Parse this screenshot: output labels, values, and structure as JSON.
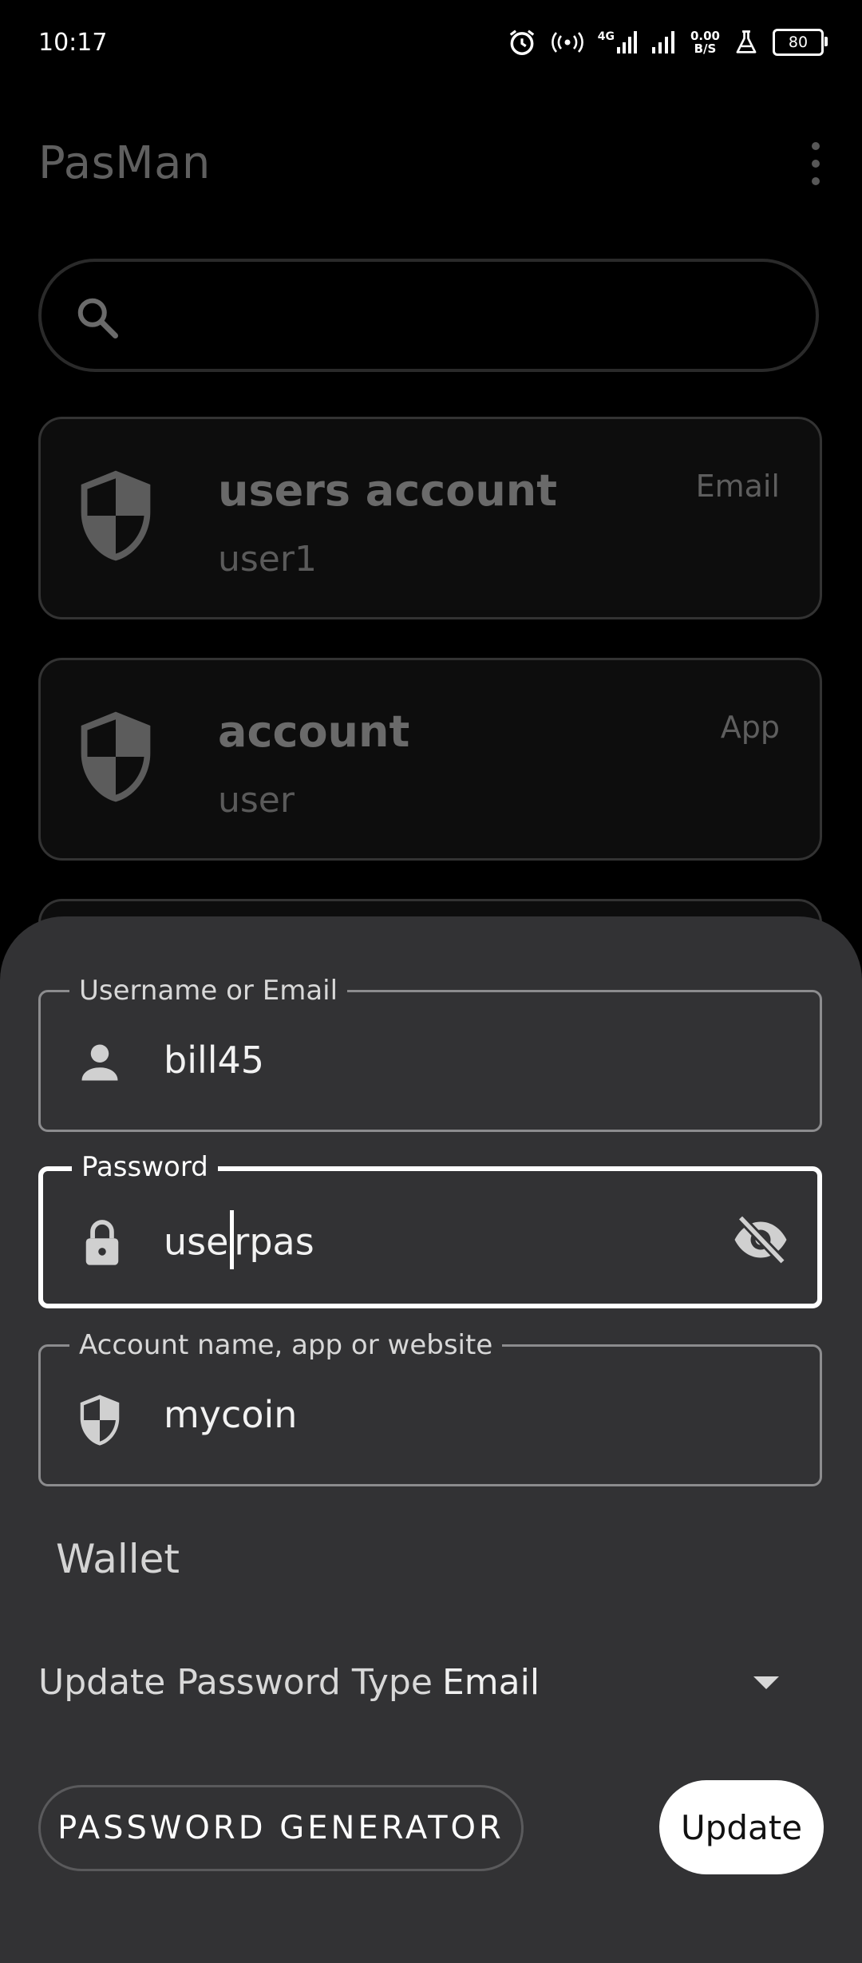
{
  "status_bar": {
    "time": "10:17",
    "network": "4G",
    "speed_value": "0.00",
    "speed_unit": "B/S",
    "battery": "80"
  },
  "app": {
    "title": "PasMan"
  },
  "search": {
    "placeholder": ""
  },
  "accounts": [
    {
      "name": "users account",
      "username": "user1",
      "type": "Email"
    },
    {
      "name": "account",
      "username": "user",
      "type": "App"
    }
  ],
  "form": {
    "username": {
      "label": "Username or Email",
      "value": "bill45"
    },
    "password": {
      "label": "Password",
      "value_before_cursor": "use",
      "value_after_cursor": "rpas"
    },
    "account": {
      "label": "Account name, app or website",
      "value": "mycoin"
    },
    "category": "Wallet",
    "password_type": {
      "label": "Update Password Type",
      "value": "Email"
    },
    "generator_button": "PASSWORD GENERATOR",
    "update_button": "Update"
  },
  "colors": {
    "background": "#000000",
    "sheet": "#323234",
    "accent": "#ffffff"
  }
}
